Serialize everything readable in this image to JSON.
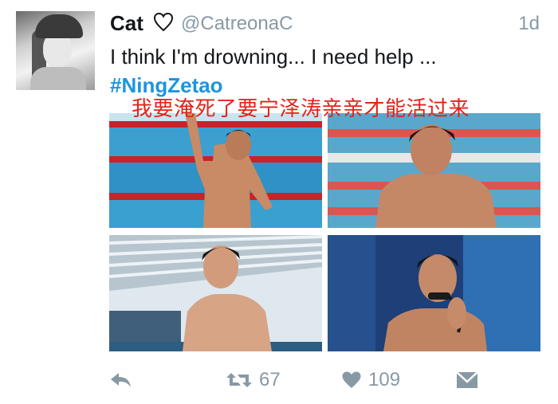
{
  "tweet": {
    "display_name": "Cat",
    "handle": "@CatreonaC",
    "timestamp": "1d",
    "text": "I think I'm drowning... I need help ...",
    "hashtag": "#NingZetao",
    "overlay_caption": "我要淹死了要宁泽涛亲亲才能活过来"
  },
  "actions": {
    "retweet_count": "67",
    "like_count": "109"
  },
  "icons": {
    "reply": "reply-icon",
    "retweet": "retweet-icon",
    "like": "heart-icon",
    "direct_message": "direct-message-icon",
    "name_badge": "heart-outline-icon"
  },
  "colors": {
    "hashtag": "#1b95e0",
    "secondary_text": "#8899a6",
    "caption": "#e0241b"
  }
}
